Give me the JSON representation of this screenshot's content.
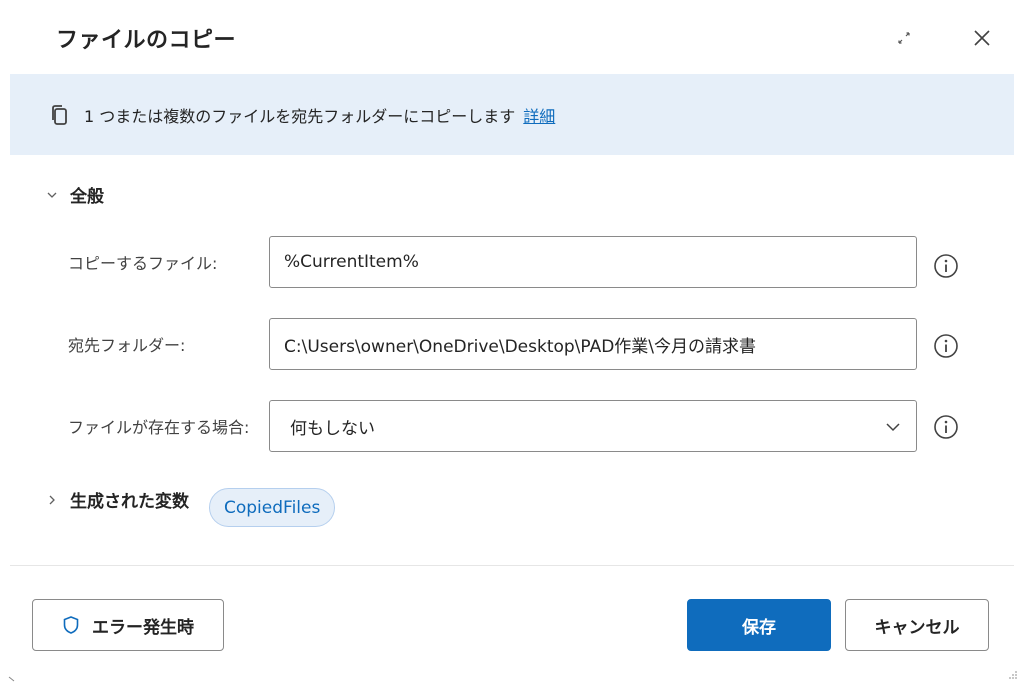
{
  "dialog": {
    "title": "ファイルのコピー"
  },
  "banner": {
    "text": "1 つまたは複数のファイルを宛先フォルダーにコピーします",
    "link": "詳細"
  },
  "sections": {
    "general": "全般",
    "variables": "生成された変数"
  },
  "fields": {
    "files_to_copy": {
      "label": "コピーするファイル:",
      "value": "%CurrentItem%"
    },
    "destination": {
      "label": "宛先フォルダー:",
      "value": "C:\\Users\\owner\\OneDrive\\Desktop\\PAD作業\\今月の請求書"
    },
    "if_exists": {
      "label": "ファイルが存在する場合:",
      "value": "何もしない"
    }
  },
  "variables": [
    "CopiedFiles"
  ],
  "footer": {
    "on_error": "エラー発生時",
    "save": "保存",
    "cancel": "キャンセル"
  },
  "colors": {
    "accent": "#0f6cbd",
    "banner_bg": "#e6eff9"
  }
}
